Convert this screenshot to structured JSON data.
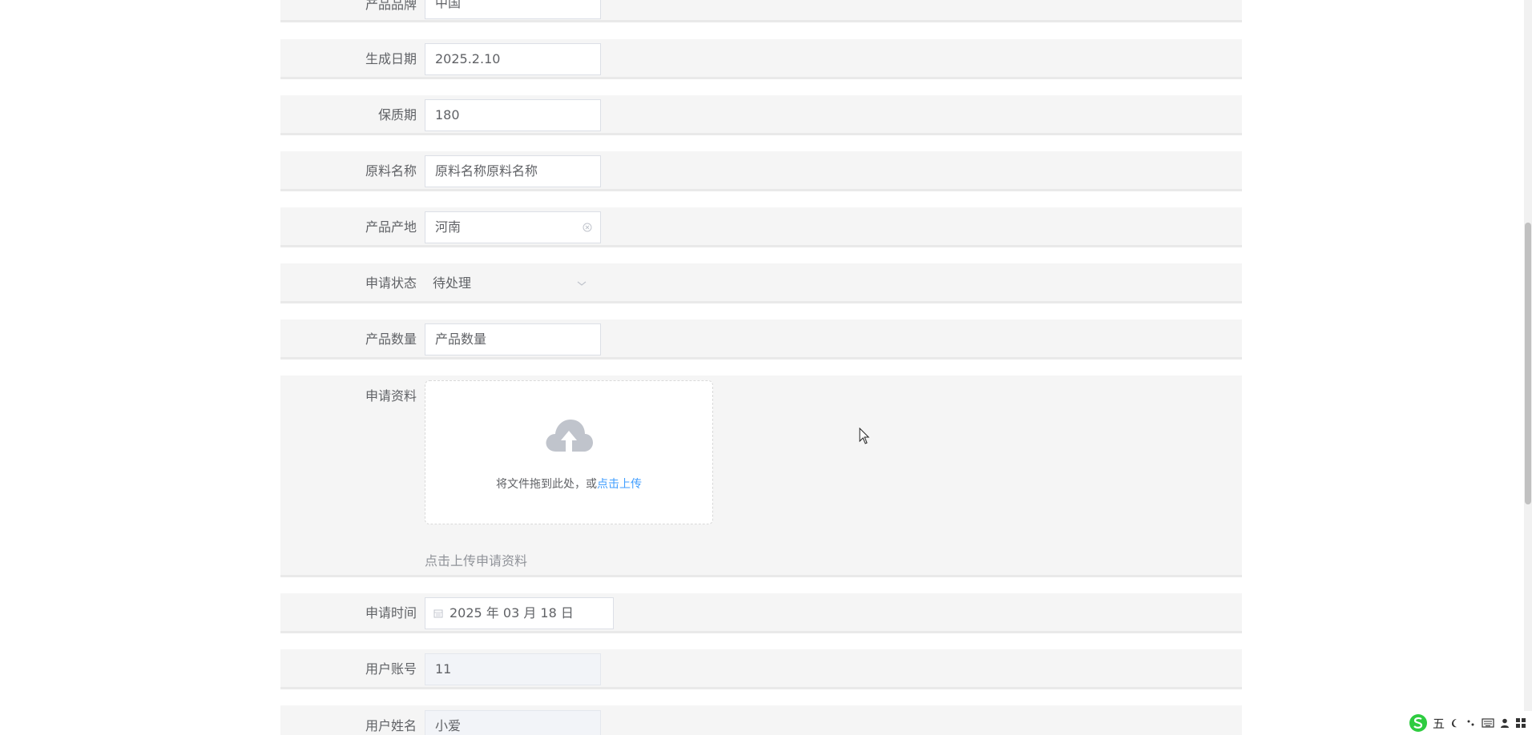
{
  "form": {
    "rows": [
      {
        "label": "产品品牌",
        "value": "中国"
      },
      {
        "label": "生成日期",
        "value": "2025.2.10"
      },
      {
        "label": "保质期",
        "value": "180"
      },
      {
        "label": "原料名称",
        "value": "原料名称原料名称"
      },
      {
        "label": "产品产地",
        "value": "河南"
      },
      {
        "label": "申请状态",
        "value": "待处理"
      },
      {
        "label": "产品数量",
        "placeholder": "产品数量"
      },
      {
        "label": "申请资料"
      },
      {
        "label": "申请时间",
        "value": "2025 年 03 月 18 日"
      },
      {
        "label": "用户账号",
        "value": "11"
      },
      {
        "label": "用户姓名",
        "value": "小爱"
      }
    ],
    "upload": {
      "text": "将文件拖到此处，或",
      "link": "点击上传",
      "tip": "点击上传申请资料"
    }
  },
  "ime": {
    "mode": "五",
    "logo": "sogou-ime-icon"
  }
}
